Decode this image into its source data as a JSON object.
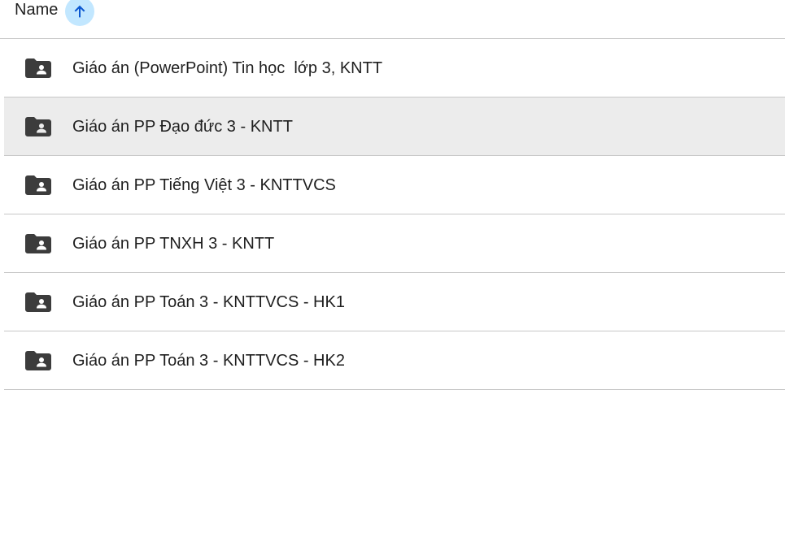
{
  "header": {
    "column_label": "Name",
    "sort_icon": "arrow-upward-icon",
    "sort_direction": "ascending"
  },
  "folders": [
    {
      "name": "Giáo án (PowerPoint) Tin học  lớp 3, KNTT",
      "icon": "shared-folder-icon",
      "selected": false
    },
    {
      "name": "Giáo án PP Đạo đức 3 - KNTT",
      "icon": "shared-folder-icon",
      "selected": true
    },
    {
      "name": "Giáo án PP Tiếng Việt 3 - KNTTVCS",
      "icon": "shared-folder-icon",
      "selected": false
    },
    {
      "name": "Giáo án PP TNXH 3 - KNTT",
      "icon": "shared-folder-icon",
      "selected": false
    },
    {
      "name": "Giáo án PP Toán 3 - KNTTVCS - HK1",
      "icon": "shared-folder-icon",
      "selected": false
    },
    {
      "name": "Giáo án PP Toán 3 - KNTTVCS - HK2",
      "icon": "shared-folder-icon",
      "selected": false
    }
  ],
  "colors": {
    "sort_button_bg": "#c2e7ff",
    "sort_arrow": "#0b57d0",
    "selected_row_bg": "#ececec",
    "folder_icon": "#3c3c3c",
    "divider": "#c7c7c7"
  }
}
